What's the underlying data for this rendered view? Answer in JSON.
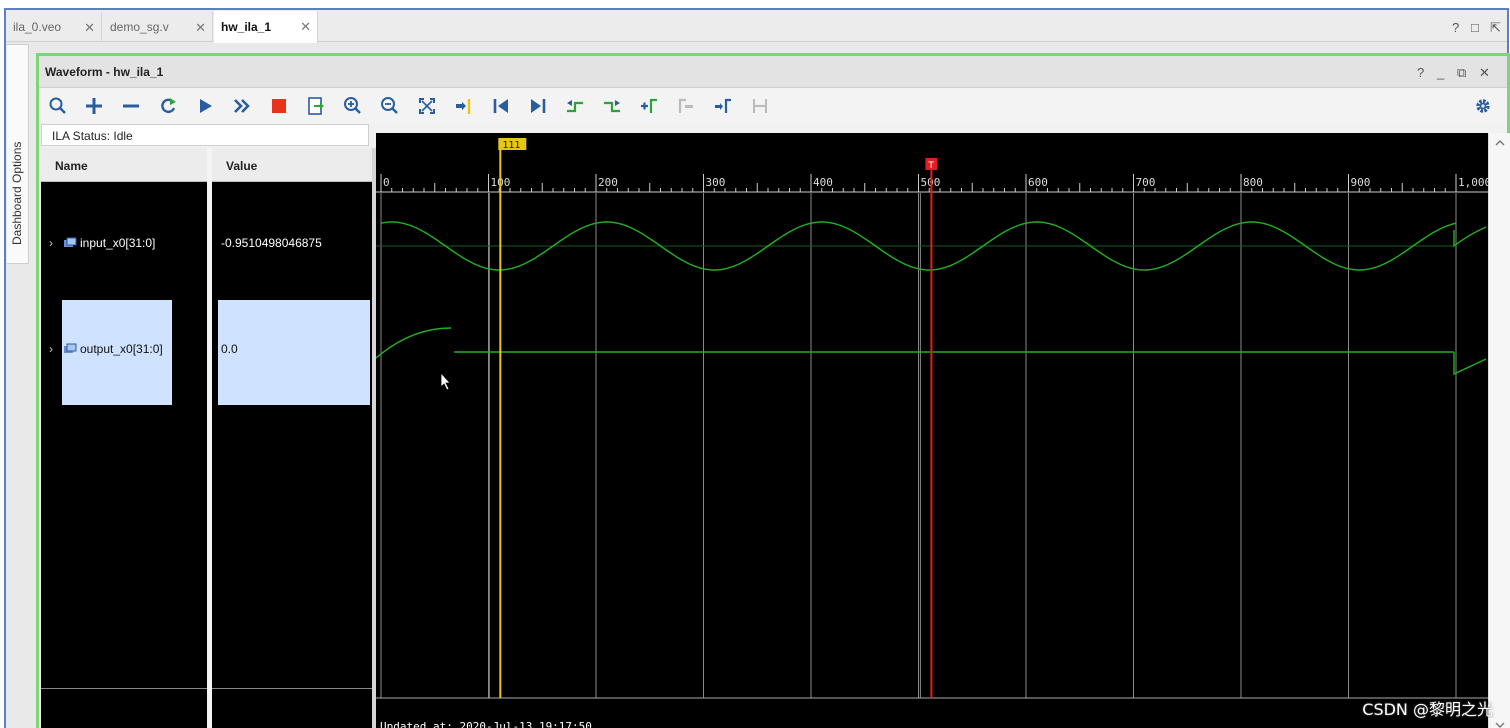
{
  "tabs": [
    {
      "label": "ila_0.veo",
      "active": false
    },
    {
      "label": "demo_sg.v",
      "active": false
    },
    {
      "label": "hw_ila_1",
      "active": true
    }
  ],
  "window_controls": [
    "?",
    "□",
    "⇱"
  ],
  "side_panel": {
    "label": "Dashboard Options"
  },
  "panel": {
    "title": "Waveform - hw_ila_1",
    "controls": [
      "?",
      "_",
      "⧉",
      "✕"
    ]
  },
  "toolbar": {
    "buttons": [
      "search",
      "zoom-add",
      "remove",
      "refresh",
      "run",
      "run-fast",
      "stop",
      "export",
      "zoom-in",
      "zoom-out",
      "zoom-fit",
      "go-to-cursor",
      "go-to-start",
      "go-to-end",
      "prev-transition",
      "next-transition",
      "add-marker",
      "prev-marker",
      "next-marker",
      "swap-cursors",
      "settings"
    ]
  },
  "ila_status": "ILA Status: Idle",
  "columns": {
    "name": "Name",
    "value": "Value"
  },
  "signals": [
    {
      "name": "input_x0[31:0]",
      "value": "-0.9510498046875",
      "selected": false
    },
    {
      "name": "output_x0[31:0]",
      "value": "0.0",
      "selected": true
    }
  ],
  "timeline": {
    "ticks": [
      "0",
      "100",
      "200",
      "300",
      "400",
      "500",
      "600",
      "700",
      "800",
      "900",
      "1,000"
    ],
    "cursor_label": "111",
    "trigger_label": "T",
    "cursor_value": 111,
    "trigger_value": 512
  },
  "updated": "Updated at: 2020-Jul-13 19:17:50",
  "watermark": "CSDN @黎明之光",
  "colors": {
    "wave": "#22b022",
    "cursor": "#e6c619",
    "trigger": "#e02020",
    "selection": "#cfe2ff",
    "panel_border": "#7fd37a"
  }
}
